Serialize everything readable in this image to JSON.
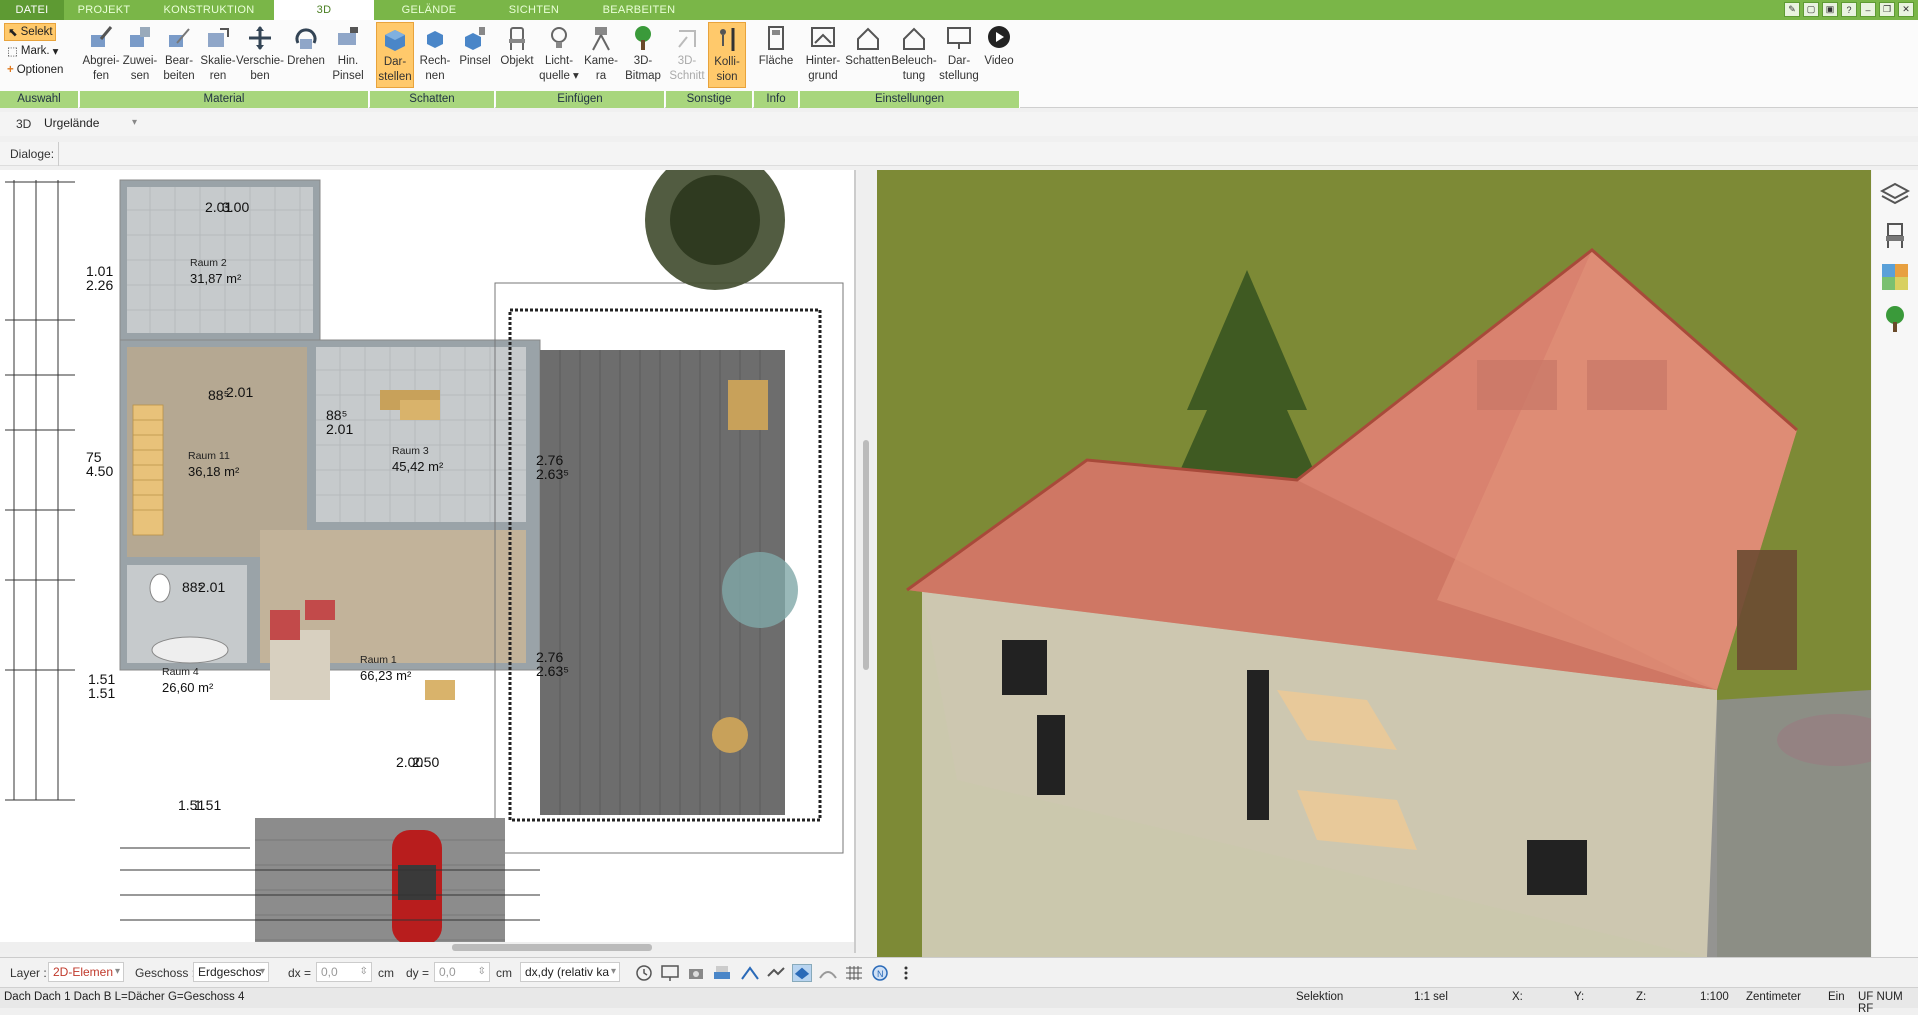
{
  "menu": {
    "tabs": [
      "DATEI",
      "PROJEKT",
      "KONSTRUKTION",
      "3D",
      "GELÄNDE",
      "SICHTEN",
      "BEARBEITEN"
    ],
    "active": "3D"
  },
  "ribbon": {
    "selection": {
      "selekt": "Selekt",
      "mark": "Mark.",
      "optionen": "Optionen",
      "group": "Auswahl"
    },
    "groups": {
      "material": "Material",
      "schatten": "Schatten",
      "einfuegen": "Einfügen",
      "sonstige": "Sonstige",
      "info": "Info",
      "einstellungen": "Einstellungen"
    },
    "buttons": {
      "abgreifen": [
        "Abgrei-",
        "fen"
      ],
      "zuweisen": [
        "Zuwei-",
        "sen"
      ],
      "bearbeiten": [
        "Bear-",
        "beiten"
      ],
      "skalieren": [
        "Skalie-",
        "ren"
      ],
      "verschieben": [
        "Verschie-",
        "ben"
      ],
      "drehen": [
        "Drehen",
        ""
      ],
      "hinpinsel": [
        "Hin.",
        "Pinsel"
      ],
      "darstellen": [
        "Dar-",
        "stellen"
      ],
      "rechnen": [
        "Rech-",
        "nen"
      ],
      "pinsel": [
        "Pinsel",
        ""
      ],
      "objekt": [
        "Objekt",
        ""
      ],
      "lichtquelle": [
        "Licht-",
        "quelle ▾"
      ],
      "kamera": [
        "Kame-",
        "ra"
      ],
      "bitmap": [
        "3D-",
        "Bitmap"
      ],
      "schnitt": [
        "3D-",
        "Schnitt"
      ],
      "kollision": [
        "Kolli-",
        "sion"
      ],
      "flaeche": [
        "Fläche",
        ""
      ],
      "hintergrund": [
        "Hinter-",
        "grund"
      ],
      "schatten2": [
        "Schatten",
        ""
      ],
      "beleuchtung": [
        "Beleuch-",
        "tung"
      ],
      "darstellung": [
        "Dar-",
        "stellung"
      ],
      "video": [
        "Video",
        ""
      ]
    }
  },
  "row2": {
    "mode": "3D",
    "element": "Urgelände"
  },
  "row3": {
    "dialoge": "Dialoge:"
  },
  "plan": {
    "rooms": [
      {
        "name": "Raum 2",
        "area": "31,87 m²"
      },
      {
        "name": "Raum 11",
        "area": "36,18 m²"
      },
      {
        "name": "Raum 3",
        "area": "45,42 m²"
      },
      {
        "name": "Raum 1",
        "area": "66,23 m²"
      },
      {
        "name": "Raum 4",
        "area": "26,60 m²"
      }
    ],
    "dims": {
      "d1": "1.01",
      "d2": "2.26",
      "d3": "75",
      "d4": "4.50",
      "d5": "1.51",
      "d6": "1.51",
      "d7": "2.01",
      "d8": "3.00",
      "d9": "88⁵",
      "d10": "2.01",
      "d11": "88⁵",
      "d12": "2.01",
      "d13": "2.76",
      "d14": "2.63⁵",
      "d15": "2.76",
      "d16": "2.63⁵",
      "d17": "88⁵",
      "d18": "2.01",
      "d19": "2.00",
      "d20": "2.50",
      "d21": "1.51",
      "d22": "1.51"
    }
  },
  "bottom": {
    "layer_label": "Layer :",
    "layer_value": "2D-Elemen",
    "geschoss_label": "Geschoss :",
    "geschoss_value": "Erdgeschos",
    "dx_label": "dx =",
    "dx_value": "0,0",
    "dx_unit": "cm",
    "dy_label": "dy =",
    "dy_value": "0,0",
    "dy_unit": "cm",
    "mode_value": "dx,dy (relativ ka"
  },
  "status": {
    "left": "Dach Dach 1 Dach B L=Dächer G=Geschoss 4",
    "selektion": "Selektion",
    "sel": "1:1 sel",
    "x": "X:",
    "y": "Y:",
    "z": "Z:",
    "scale": "1:100",
    "unit": "Zentimeter",
    "ein": "Ein",
    "flags": "UF NUM RF"
  },
  "colors": {
    "accent": "#7ab648",
    "ribbon_group": "#a8d67d",
    "active_btn": "#ffc96b",
    "roof": "#d9826f",
    "grass": "#7d8a36"
  }
}
